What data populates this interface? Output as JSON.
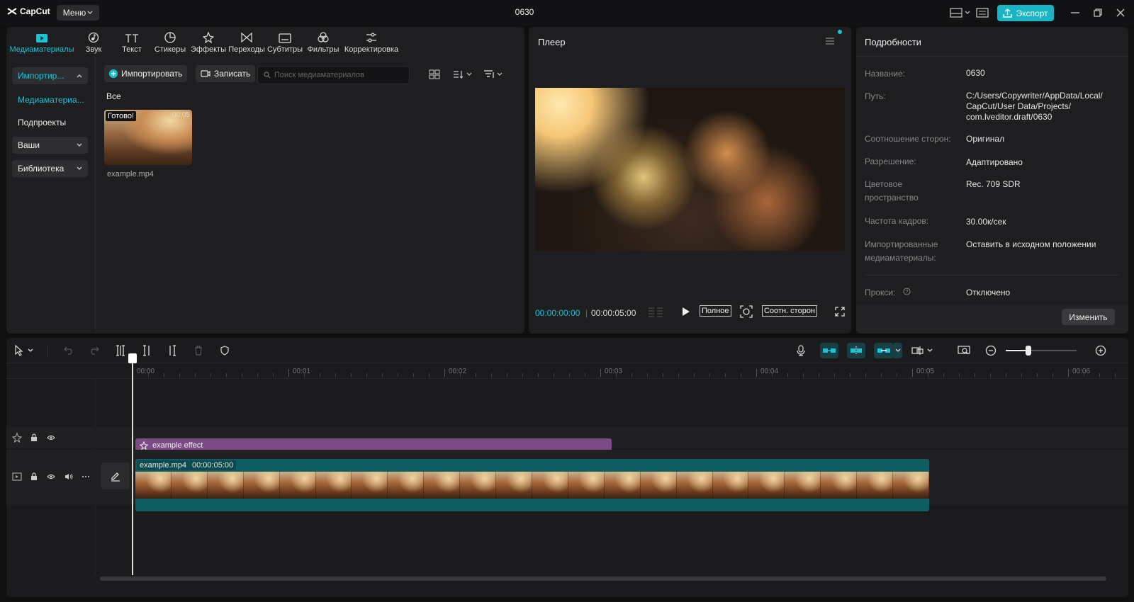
{
  "app": {
    "logo": "CapCut",
    "menu_label": "Меню",
    "project_title": "0630",
    "export_label": "Экспорт"
  },
  "media": {
    "tabs": [
      {
        "label": "Медиаматериалы",
        "icon": "media-icon",
        "active": true
      },
      {
        "label": "Звук",
        "icon": "audio-icon"
      },
      {
        "label": "Текст",
        "icon": "text-icon"
      },
      {
        "label": "Стикеры",
        "icon": "sticker-icon"
      },
      {
        "label": "Эффекты",
        "icon": "effects-icon"
      },
      {
        "label": "Переходы",
        "icon": "transitions-icon"
      },
      {
        "label": "Субтитры",
        "icon": "subtitles-icon"
      },
      {
        "label": "Фильтры",
        "icon": "filters-icon"
      },
      {
        "label": "Корректировка",
        "icon": "adjust-icon"
      }
    ],
    "sidebar": {
      "import_label": "Импортир...",
      "media_link": "Медиаматериа...",
      "subprojects": "Подпроекты",
      "yours": "Ваши",
      "library": "Библиотека"
    },
    "toolbar": {
      "import_button": "Импортировать",
      "record_button": "Записать",
      "search_placeholder": "Поиск медиаматериалов"
    },
    "section_label": "Все",
    "items": [
      {
        "name": "example.mp4",
        "badge": "Готово!",
        "duration": "00:05"
      }
    ]
  },
  "player": {
    "title": "Плеер",
    "current_time": "00:00:00:00",
    "total_time": "00:00:05:00",
    "full_label": "Полное",
    "aspect_label": "Соотн. сторон"
  },
  "details": {
    "title": "Подробности",
    "rows": [
      {
        "label": "Название:",
        "value": "0630"
      },
      {
        "label": "Путь:",
        "value": "C:/Users/Copywriter/AppData/Local/ CapCut/User Data/Projects/ com.lveditor.draft/0630"
      },
      {
        "label": "Соотношение сторон:",
        "value": "Оригинал"
      },
      {
        "label": "Разрешение:",
        "value": "Адаптировано"
      },
      {
        "label": "Цветовое пространство",
        "value": "Rec. 709 SDR"
      },
      {
        "label": "Частота кадров:",
        "value": "30.00к/сек"
      },
      {
        "label": "Импортированные медиаматериалы:",
        "value": "Оставить в исходном положении"
      },
      {
        "label": "Прокси:",
        "value": "Отключено"
      }
    ],
    "change_button": "Изменить"
  },
  "timeline": {
    "ruler": [
      "00:00",
      "00:01",
      "00:02",
      "00:03",
      "00:04",
      "00:05",
      "00:06"
    ],
    "effect_clip": "example effect",
    "video_clip_name": "example.mp4",
    "video_clip_duration": "00:00:05:00"
  },
  "colors": {
    "accent": "#19c3d4",
    "effect_clip": "#7a4b85",
    "video_clip": "#0e5d60"
  }
}
